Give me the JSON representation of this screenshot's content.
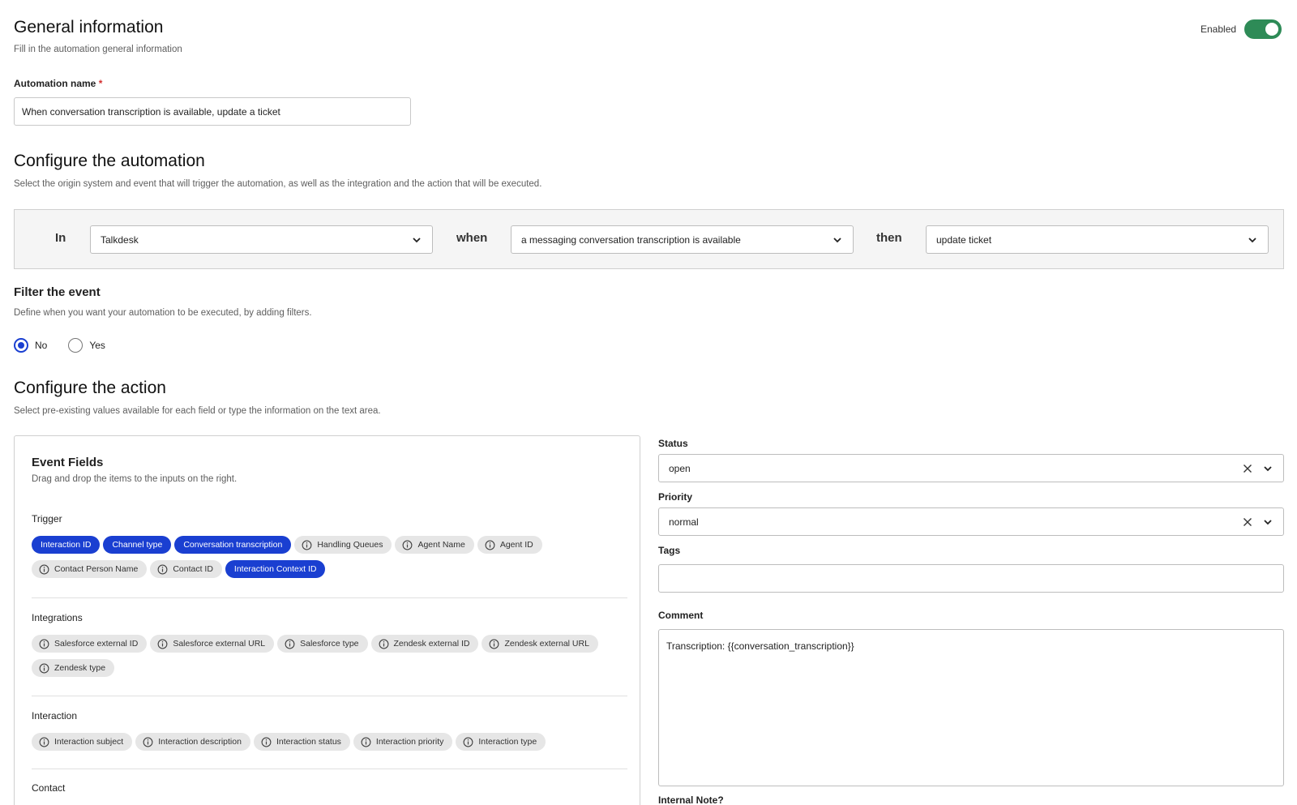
{
  "general": {
    "title": "General information",
    "subtitle": "Fill in the automation general information",
    "enabled_label": "Enabled",
    "enabled": true,
    "name_label": "Automation name",
    "required_mark": "*",
    "name_value": "When conversation transcription is available, update a ticket"
  },
  "configure": {
    "title": "Configure the automation",
    "subtitle": "Select the origin system and event that will trigger the automation, as well as the integration and the action that will be executed.",
    "in_label": "In",
    "in_value": "Talkdesk",
    "when_label": "when",
    "when_value": "a messaging conversation transcription is available",
    "then_label": "then",
    "then_value": "update ticket"
  },
  "filter": {
    "title": "Filter the event",
    "subtitle": "Define when you want your automation to be executed, by adding filters.",
    "options": [
      "No",
      "Yes"
    ],
    "selected": "No"
  },
  "action": {
    "title": "Configure the action",
    "subtitle": "Select pre-existing values available for each field or type the information on the text area."
  },
  "event_fields": {
    "title": "Event Fields",
    "subtitle": "Drag and drop the items to the inputs on the right.",
    "groups": [
      {
        "title": "Trigger",
        "chips": [
          {
            "label": "Interaction ID",
            "selected": true
          },
          {
            "label": "Channel type",
            "selected": true
          },
          {
            "label": "Conversation transcription",
            "selected": true
          },
          {
            "label": "Handling Queues",
            "selected": false
          },
          {
            "label": "Agent Name",
            "selected": false
          },
          {
            "label": "Agent ID",
            "selected": false
          },
          {
            "label": "Contact Person Name",
            "selected": false
          },
          {
            "label": "Contact ID",
            "selected": false
          },
          {
            "label": "Interaction Context ID",
            "selected": true
          }
        ]
      },
      {
        "title": "Integrations",
        "chips": [
          {
            "label": "Salesforce external ID",
            "selected": false
          },
          {
            "label": "Salesforce external URL",
            "selected": false
          },
          {
            "label": "Salesforce type",
            "selected": false
          },
          {
            "label": "Zendesk external ID",
            "selected": false
          },
          {
            "label": "Zendesk external URL",
            "selected": false
          },
          {
            "label": "Zendesk type",
            "selected": false
          }
        ]
      },
      {
        "title": "Interaction",
        "chips": [
          {
            "label": "Interaction subject",
            "selected": false
          },
          {
            "label": "Interaction description",
            "selected": false
          },
          {
            "label": "Interaction status",
            "selected": false
          },
          {
            "label": "Interaction priority",
            "selected": false
          },
          {
            "label": "Interaction type",
            "selected": false
          }
        ]
      },
      {
        "title": "Contact",
        "chips": []
      }
    ]
  },
  "ticket": {
    "status_label": "Status",
    "status_value": "open",
    "priority_label": "Priority",
    "priority_value": "normal",
    "tags_label": "Tags",
    "tags_value": "",
    "comment_label": "Comment",
    "comment_value": "Transcription: {{conversation_transcription}}",
    "internal_note_label": "Internal Note?"
  },
  "colors": {
    "accent": "#1a3fd1",
    "toggle_on": "#2e8b57",
    "chip_bg": "#e6e6e6"
  },
  "icons": {
    "select_arrow": "chevron-down-icon",
    "clear": "close-icon",
    "chip_info": "info-icon"
  }
}
